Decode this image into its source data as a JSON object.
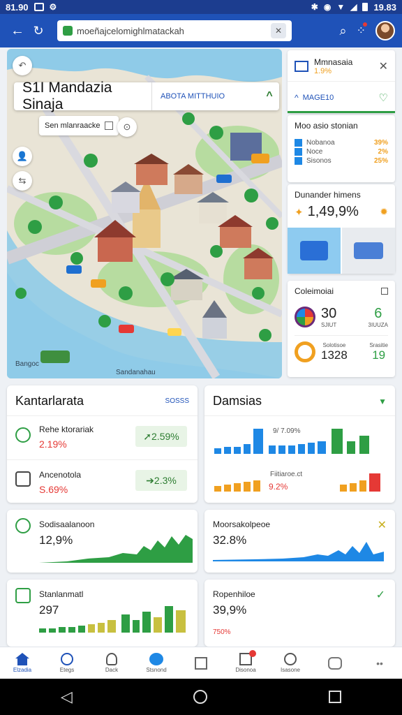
{
  "status_bar": {
    "time": "81.90",
    "right_time": "19.83"
  },
  "browser": {
    "url": "moeñajcelomighlmatackah"
  },
  "map": {
    "title": "S1I Mandazia Sinaja",
    "subtitle": "ABOTA MITTHUIO",
    "chip_label": "Sen mlanraacke",
    "bottom_left_label": "Bangoc",
    "bottom_right_label": "Sandanahau"
  },
  "right_panel": {
    "card1": {
      "title": "Mmnasaia",
      "value": "1.9%",
      "sub": "MAGE10"
    },
    "card2": {
      "title": "Moo asio stonian",
      "rows": [
        {
          "label": "Nobanoa",
          "value": "39%"
        },
        {
          "label": "Noce",
          "value": "2%"
        },
        {
          "label": "Sisonos",
          "value": "25%"
        }
      ]
    },
    "card3": {
      "title": "Dunander himens",
      "value": "1,49,9%"
    },
    "card4": {
      "title": "Coleimoiai",
      "a_value": "30",
      "a_label": "SJIUT",
      "a_value2": "6",
      "a_label2": "3IUUZA",
      "b_label": "Solotisoe",
      "b_value": "1328",
      "b_label2": "Srasitie",
      "b_value2": "19"
    }
  },
  "stats": {
    "left1": {
      "title": "Kantarlarata",
      "link": "SOSSS",
      "row1_label": "Rehe ktorariak",
      "row1_value": "2.19%",
      "row1_pill": "2.59%",
      "row2_label": "Ancenotola",
      "row2_value": "S.69%",
      "row2_pill": "2.3%"
    },
    "right1": {
      "title": "Damsias",
      "label1": "9/ 7.09%",
      "label2": "Fiitiaroe.ct",
      "value2": "9.2%"
    },
    "left2": {
      "title": "Sodisaalanoon",
      "value": "12,9%"
    },
    "right2": {
      "title": "Moorsakolpeoe",
      "value": "32.8%"
    },
    "left3": {
      "title": "Stanlanmatl",
      "value": "297"
    },
    "right3": {
      "title": "Ropenhiloe",
      "value": "39,9%",
      "sub": "750%"
    }
  },
  "bottom_nav": [
    {
      "label": "Elzadia",
      "icon": "home-icon"
    },
    {
      "label": "Etegs",
      "icon": "clock-icon"
    },
    {
      "label": "Dack",
      "icon": "person-icon"
    },
    {
      "label": "Stsnond",
      "icon": "globe-icon"
    },
    {
      "label": "",
      "icon": "cube-icon"
    },
    {
      "label": "Disonoa",
      "icon": "inbox-icon"
    },
    {
      "label": "Isasone",
      "icon": "compass-icon"
    },
    {
      "label": "",
      "icon": "puzzle-icon"
    },
    {
      "label": "",
      "icon": "more-icon"
    }
  ],
  "colors": {
    "brand": "#1f52b8",
    "green": "#2e9e44",
    "blue": "#1e88e5",
    "orange": "#f0a020",
    "red": "#e53935"
  }
}
